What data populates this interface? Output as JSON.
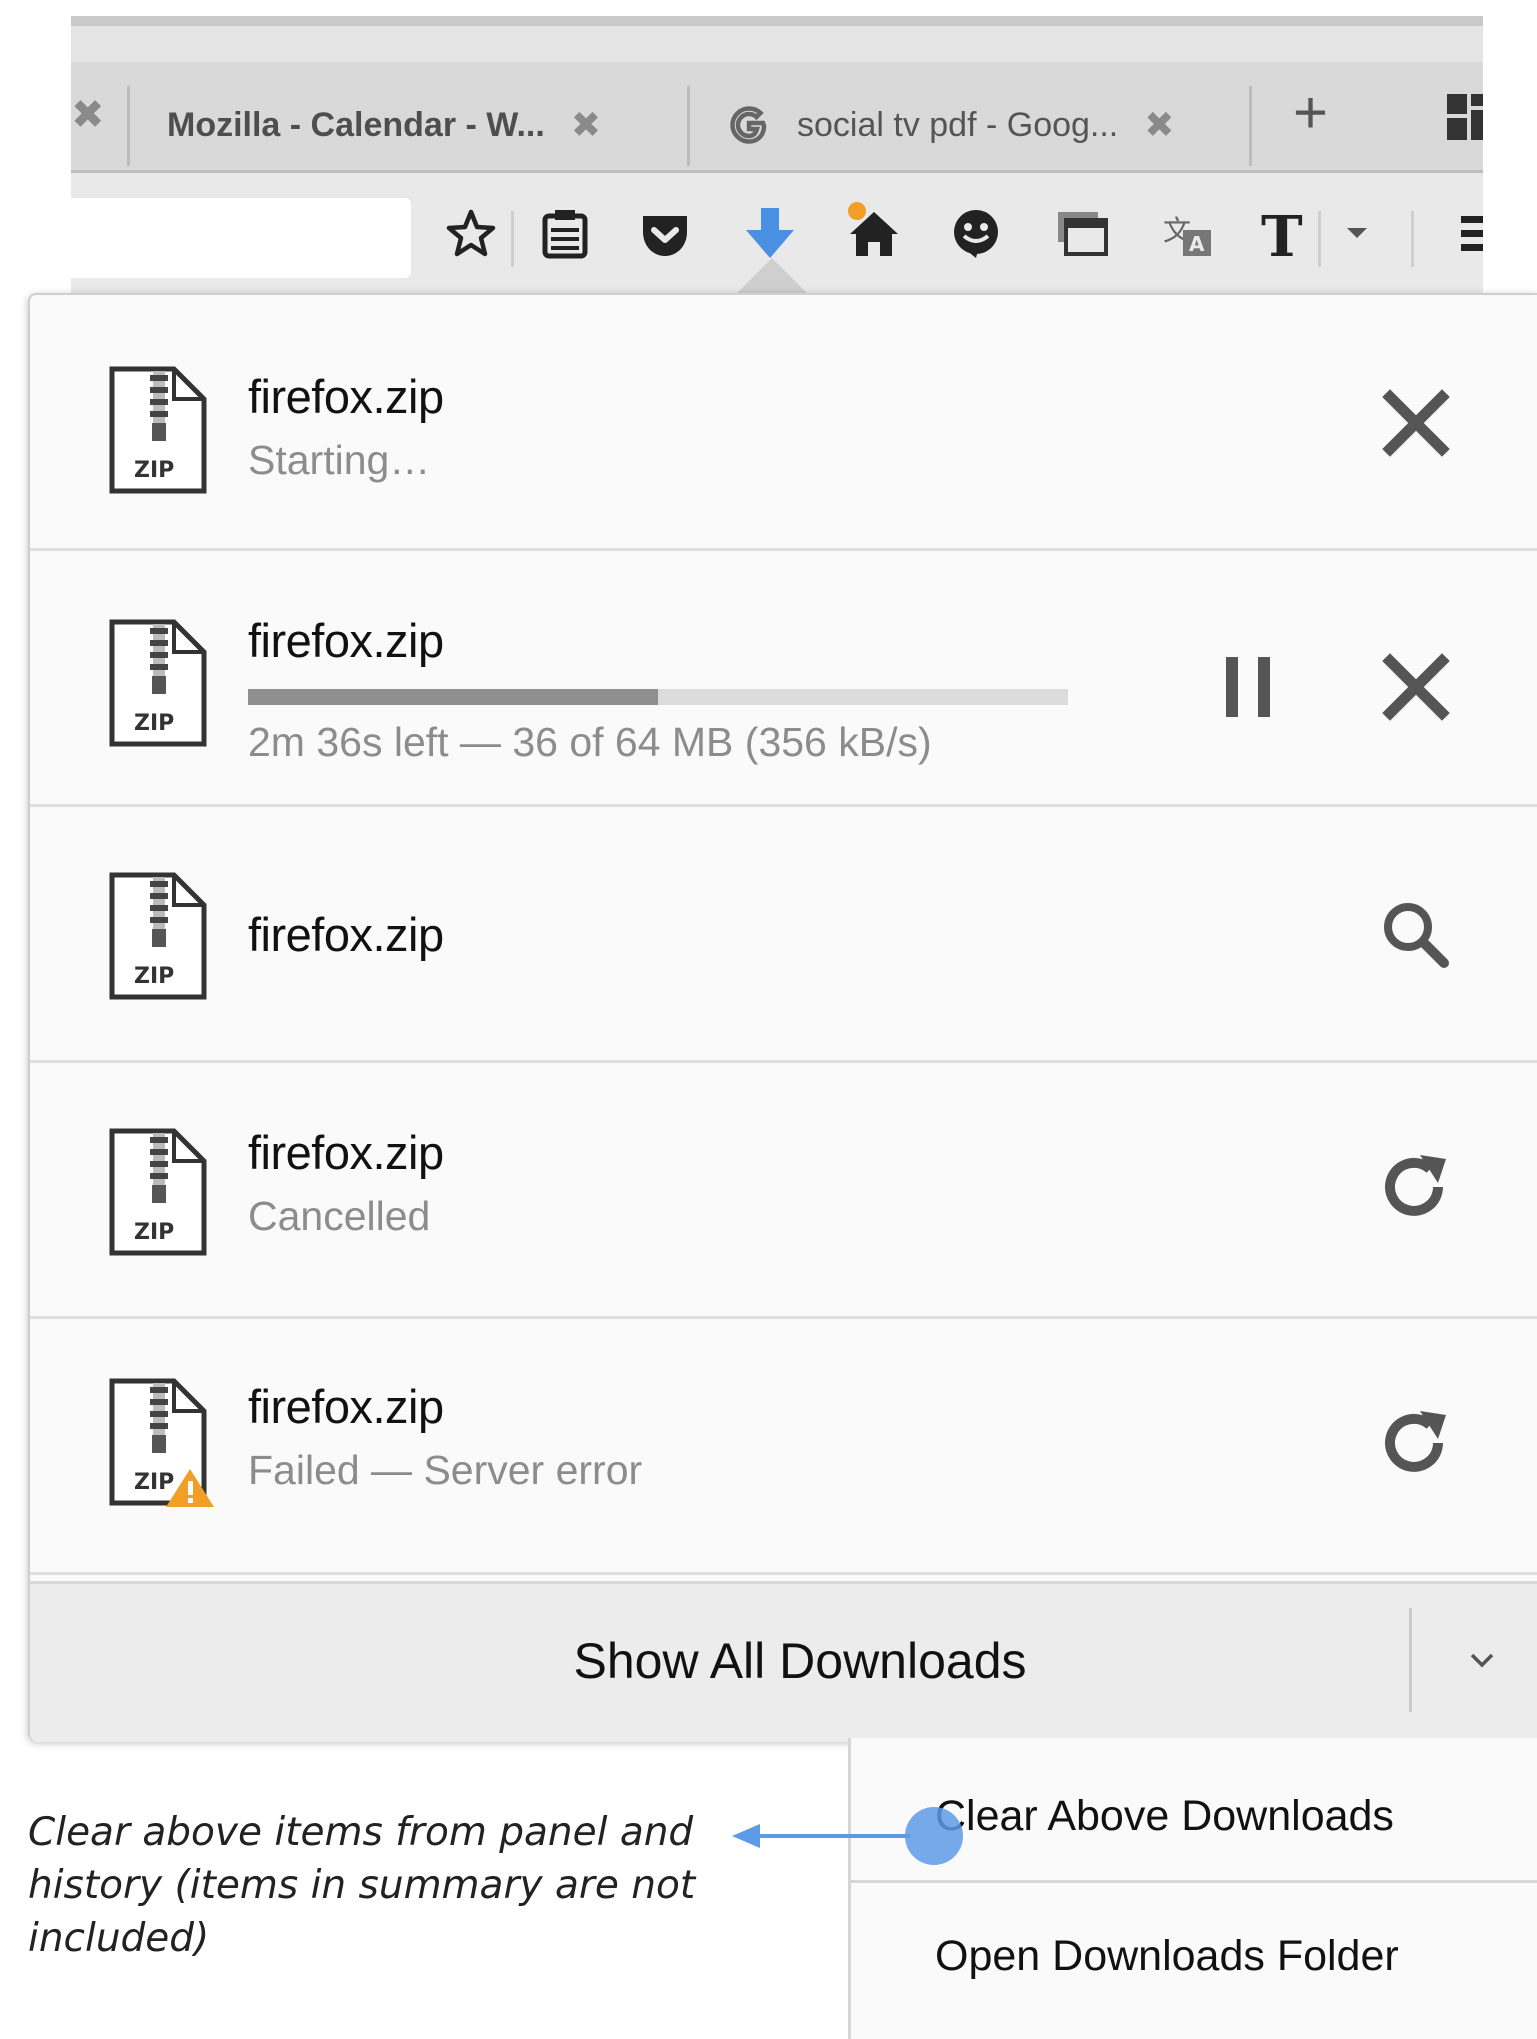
{
  "browser": {
    "tabs": [
      {
        "title": "Mozilla - Calendar - W...",
        "close": "✖"
      },
      {
        "title": "social tv pdf - Goog...",
        "close": "✖"
      }
    ],
    "newtab_label": "+",
    "toolbar_icons": [
      "star-icon",
      "reader-list-icon",
      "pocket-icon",
      "download-icon",
      "home-icon",
      "emoji-icon",
      "screenshot-icon",
      "translate-icon",
      "font-icon",
      "dropdown-arrow-icon",
      "menu-icon"
    ],
    "download_badge_color": "#f29f2a",
    "download_icon_color": "#4a90e2"
  },
  "downloads": [
    {
      "filename": "firefox.zip",
      "status": "Starting…",
      "action": "cancel"
    },
    {
      "filename": "firefox.zip",
      "status": "2m 36s left — 36 of 64 MB (356 kB/s)",
      "action": "cancel",
      "secondary_action": "pause",
      "progress": 0.5
    },
    {
      "filename": "firefox.zip",
      "status": "",
      "action": "show-in-folder"
    },
    {
      "filename": "firefox.zip",
      "status": "Cancelled",
      "action": "retry"
    },
    {
      "filename": "firefox.zip",
      "status": "Failed — Server error",
      "action": "retry",
      "warning": true
    }
  ],
  "file_icon_label": "ZIP",
  "footer": {
    "label": "Show All Downloads"
  },
  "menu": {
    "items": [
      "Clear Above Downloads",
      "Open Downloads Folder"
    ]
  },
  "annotation": "Clear above items from panel and history (items in summary are not included)",
  "colors": {
    "accent": "#5d9ae6",
    "warning": "#f29f2a"
  }
}
